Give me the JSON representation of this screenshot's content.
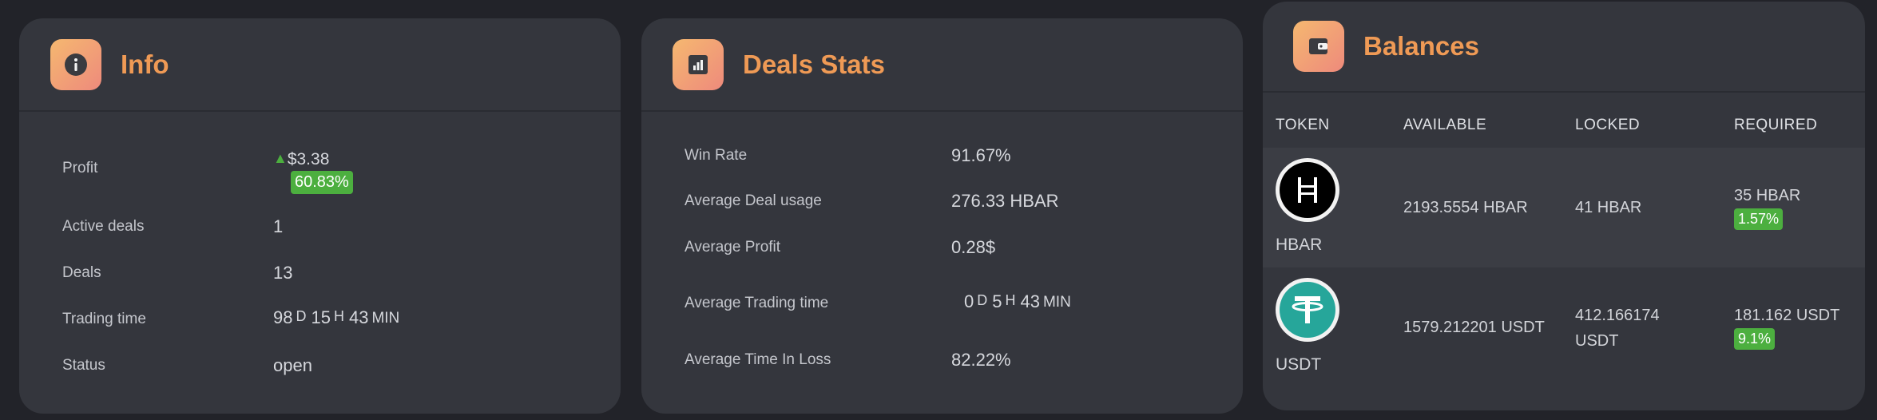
{
  "info": {
    "title": "Info",
    "rows": {
      "profit": {
        "label": "Profit",
        "value": "$3.38",
        "percent": "60.83%"
      },
      "active_deals": {
        "label": "Active deals",
        "value": "1"
      },
      "deals": {
        "label": "Deals",
        "value": "13"
      },
      "trading_time": {
        "label": "Trading time",
        "days": "98",
        "d": "D",
        "hours": "15",
        "h": "H",
        "mins": "43",
        "min": "MIN"
      },
      "status": {
        "label": "Status",
        "value": "open"
      }
    }
  },
  "deals_stats": {
    "title": "Deals Stats",
    "rows": {
      "win_rate": {
        "label": "Win Rate",
        "value": "91.67%"
      },
      "avg_usage": {
        "label": "Average Deal usage",
        "value": "276.33 HBAR"
      },
      "avg_profit": {
        "label": "Average Profit",
        "value": "0.28$"
      },
      "avg_trading_time": {
        "label": "Average Trading time",
        "days": "0",
        "d": "D",
        "hours": "5",
        "h": "H",
        "mins": "43",
        "min": "MIN"
      },
      "avg_time_loss": {
        "label": "Average Time In Loss",
        "value": "82.22%"
      }
    }
  },
  "balances": {
    "title": "Balances",
    "columns": {
      "token": "TOKEN",
      "available": "AVAILABLE",
      "locked": "LOCKED",
      "required": "REQUIRED"
    },
    "rows": [
      {
        "token": "HBAR",
        "available": "2193.5554 HBAR",
        "locked": "41 HBAR",
        "required": "35 HBAR",
        "required_pct": "1.57%"
      },
      {
        "token": "USDT",
        "available": "1579.212201 USDT",
        "locked_line1": "412.166174",
        "locked_line2": "USDT",
        "required": "181.162 USDT",
        "required_pct": "9.1%"
      }
    ]
  },
  "colors": {
    "accent": "#ef9a55",
    "positive": "#4caf3f",
    "card": "#34363d",
    "background": "#222329"
  },
  "icons": {
    "info": "info-icon",
    "deals_stats": "bar-chart-icon",
    "balances": "wallet-icon",
    "profit_trend": "triangle-up-icon"
  }
}
